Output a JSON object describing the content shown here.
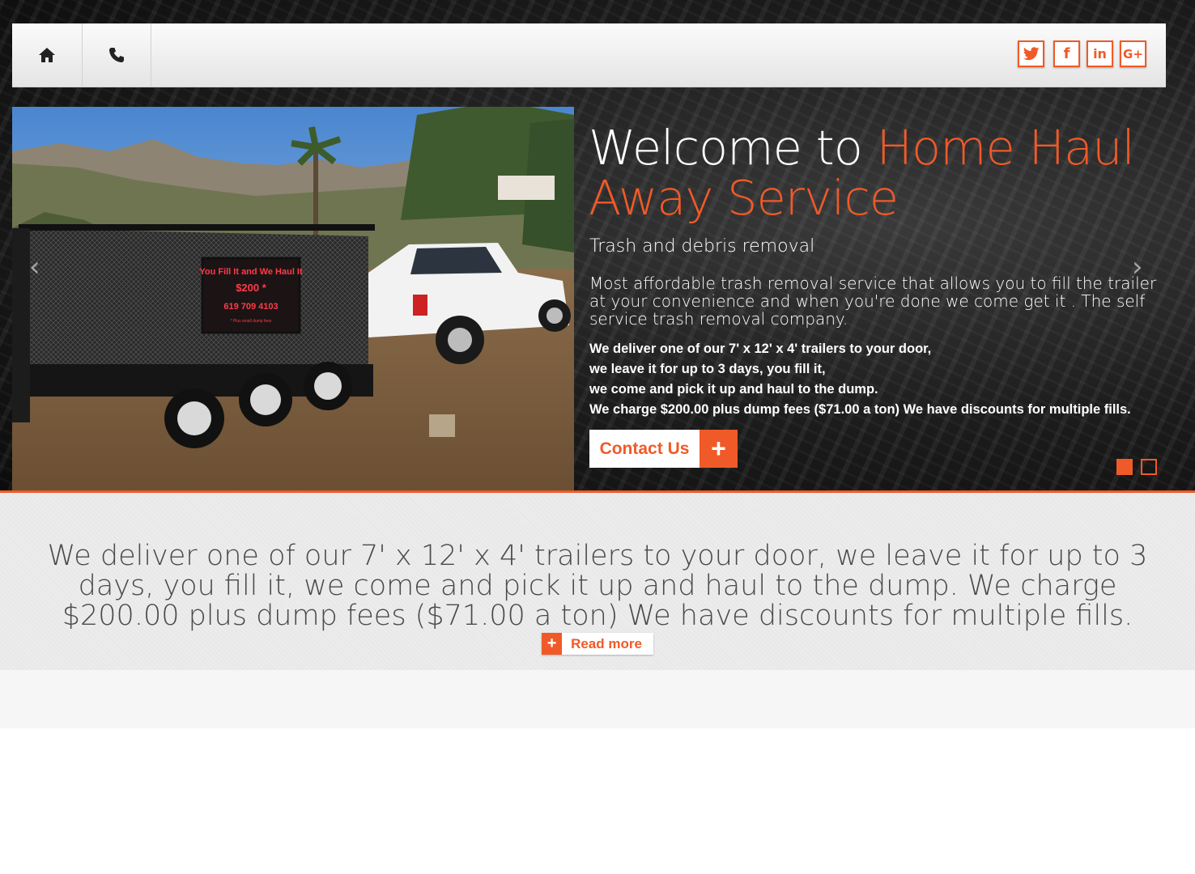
{
  "nav": {
    "home_icon": "home-icon",
    "phone_icon": "phone-icon"
  },
  "social": [
    {
      "name": "twitter-icon",
      "glyph": "t"
    },
    {
      "name": "facebook-icon",
      "glyph": "f"
    },
    {
      "name": "linkedin-icon",
      "glyph": "in"
    },
    {
      "name": "google-plus-icon",
      "glyph": "G+"
    }
  ],
  "slider": {
    "prev_arrow": "‹",
    "next_arrow": "›",
    "trailer_sign": {
      "line1": "You Fill It and We Haul It",
      "line2": "$200 *",
      "line3": "619 709 4103",
      "line4": "* Plus small dump fees"
    },
    "heading_white": "Welcome to ",
    "heading_accent": "Home Haul Away Service",
    "subtitle": "Trash and debris removal",
    "lead": "Most affordable trash removal service that allows you to fill the trailer at your convenience and when you're done we come get it . The self service trash removal company.",
    "details": [
      "We deliver one of our 7' x 12' x 4' trailers to your door,",
      "we leave it for up to 3 days, you fill it,",
      "we come and pick it up and haul to the dump.",
      "We charge $200.00 plus dump fees ($71.00 a ton) We have discounts for multiple fills."
    ],
    "contact_label": "Contact Us",
    "contact_plus": "+",
    "slide_count": 2,
    "active_slide": 1
  },
  "intro": {
    "text": "We deliver one of our 7' x 12' x 4' trailers to your door, we leave it for up to 3 days, you fill it, we come and pick it up and haul to the dump. We charge $200.00 plus dump fees ($71.00 a ton) We have discounts for multiple fills.",
    "read_more_plus": "+",
    "read_more_label": "Read more"
  },
  "colors": {
    "accent": "#f05a28",
    "hero_dark": "#1b1b1b",
    "band_gray": "#ececec"
  }
}
